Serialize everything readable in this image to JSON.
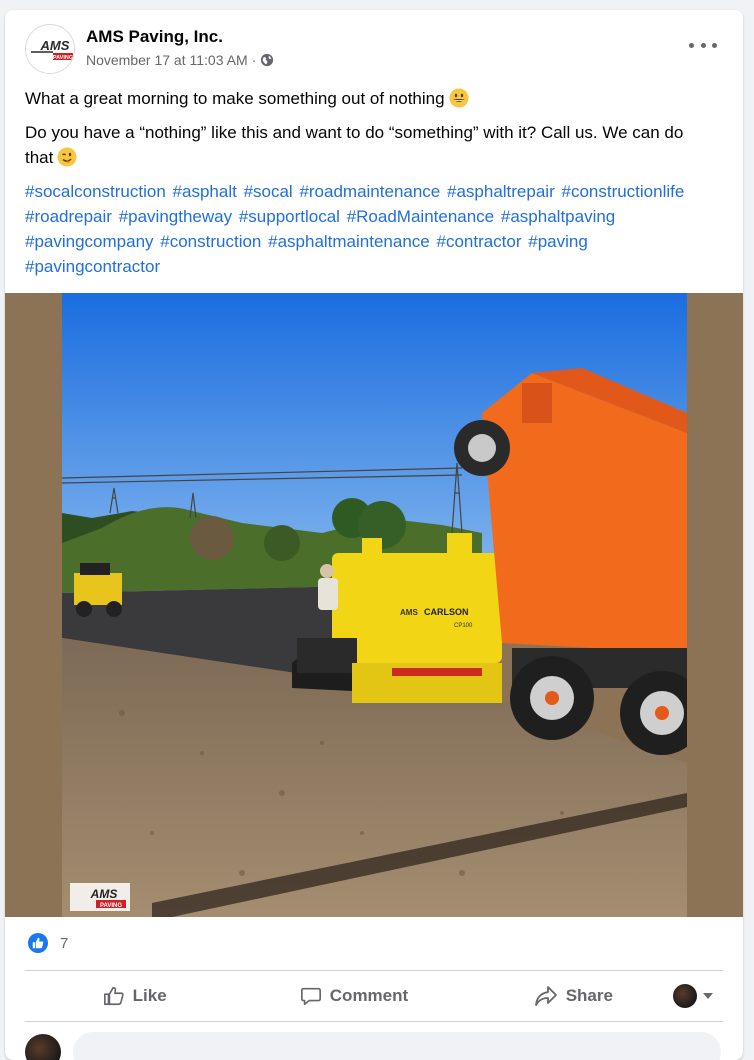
{
  "post": {
    "page_name": "AMS Paving, Inc.",
    "timestamp": "November 17 at 11:03 AM",
    "separator": "·",
    "privacy_icon": "globe-icon",
    "more_icon": "more-options-icon",
    "text_line1": "What a great morning to make something out of nothing",
    "text_line2": "Do you have a “nothing” like this and want to do “something” with it? Call us. We can do that",
    "emoji1": "grinning-face-emoji",
    "emoji2": "winking-face-emoji",
    "hashtags": [
      "#socalconstruction",
      "#asphalt",
      "#socal",
      "#roadmaintenance",
      "#asphaltrepair",
      "#constructionlife",
      "#roadrepair",
      "#pavingtheway",
      "#supportlocal",
      "#RoadMaintenance",
      "#asphaltpaving",
      "#pavingcompany",
      "#construction",
      "#asphaltmaintenance",
      "#contractor",
      "#paving",
      "#pavingcontractor"
    ],
    "logo_text_top": "AMS",
    "logo_text_bottom": "PAVING",
    "photo_machine_brand": "CARLSON",
    "photo_machine_prefix": "AMS",
    "photo_machine_model": "CP100"
  },
  "reactions": {
    "icon": "like-reaction-icon",
    "count": "7"
  },
  "actions": {
    "like_label": "Like",
    "comment_label": "Comment",
    "share_label": "Share"
  },
  "colors": {
    "hashtag": "#216fdb",
    "facebook_blue": "#1877f2",
    "secondary_text": "#65676b",
    "truck_orange": "#f26a1b",
    "paver_yellow": "#f2d515"
  }
}
